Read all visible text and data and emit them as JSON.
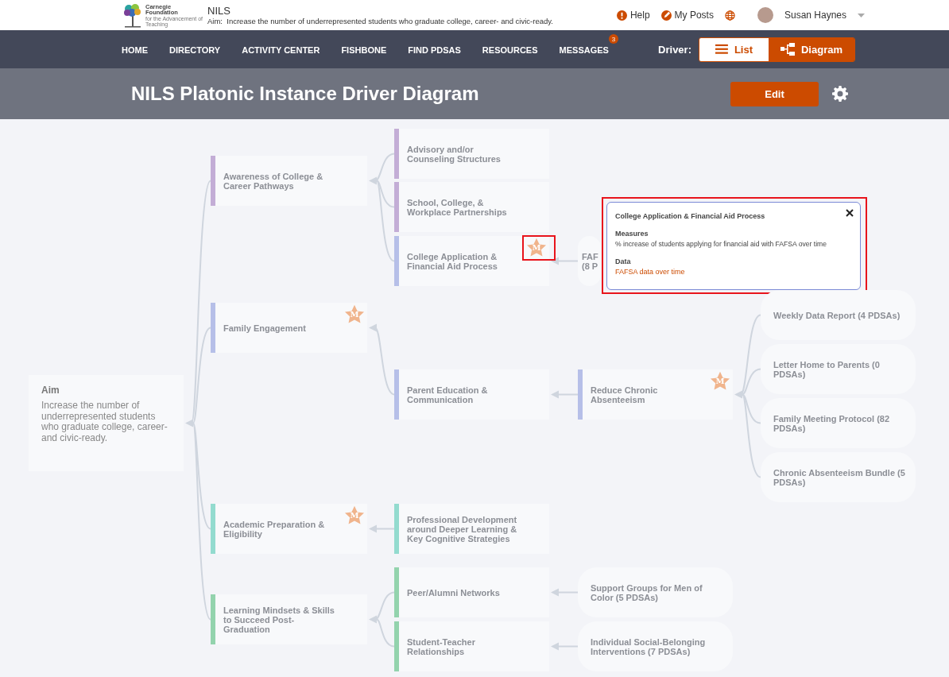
{
  "header": {
    "logo": {
      "name_lines": [
        "Carnegie",
        "Foundation"
      ],
      "tagline": "for the Advancement of Teaching"
    },
    "title": "NILS",
    "aim_line": "Aim:  Increase the number of underrepresented students who graduate college, career- and civic-ready.",
    "links": [
      {
        "kind": "help",
        "label": "Help"
      },
      {
        "kind": "posts",
        "label": "My Posts"
      },
      {
        "kind": "globe"
      }
    ],
    "user": {
      "name": "Susan Haynes"
    }
  },
  "nav": {
    "items": [
      {
        "label": "HOME"
      },
      {
        "label": "DIRECTORY"
      },
      {
        "label": "ACTIVITY CENTER"
      },
      {
        "label": "FISHBONE"
      },
      {
        "label": "FIND PDSAS"
      },
      {
        "label": "RESOURCES"
      },
      {
        "label": "MESSAGES",
        "badge": "3"
      }
    ],
    "driver_label": "Driver:",
    "views": [
      {
        "kind": "list",
        "label": "List",
        "selected": false
      },
      {
        "kind": "diagram",
        "label": "Diagram",
        "selected": true
      }
    ]
  },
  "page": {
    "title": "NILS Platonic Instance Driver Diagram",
    "edit_button": "Edit"
  },
  "diagram": {
    "aim": {
      "label": "Aim",
      "text": "Increase the number of underrepresented students who graduate college, career- and civic-ready."
    },
    "drivers": [
      {
        "kind": "driver",
        "label": "Awareness of College & Career Pathways",
        "color": "#c3add6",
        "children": [
          {
            "kind": "driver",
            "label": "Advisory and/or Counseling Structures",
            "color": "#c3add6"
          },
          {
            "kind": "driver",
            "label": "School, College, & Workplace Partnerships",
            "color": "#c3add6"
          },
          {
            "kind": "driver",
            "label": "College Application & Financial Aid Process",
            "color": "#b6bfe8",
            "badge": "M",
            "highlighted": true,
            "popup": {
              "title": "College Application & Financial Aid Process",
              "measures_heading": "Measures",
              "measures": "% increase of students applying for financial aid with FAFSA over time",
              "data_heading": "Data",
              "data": "FAFSA data over time",
              "highlighted": true
            },
            "children": [
              {
                "kind": "idea",
                "label": "FAF (8 P"
              }
            ]
          }
        ]
      },
      {
        "kind": "driver",
        "label": "Family Engagement",
        "color": "#b6bfe8",
        "badge": "M",
        "children": [
          {
            "kind": "driver",
            "label": "Parent Education & Communication",
            "color": "#b6bfe8",
            "children": [
              {
                "kind": "driver",
                "label": "Reduce Chronic Absenteeism",
                "color": "#b6bfe8",
                "badge": "M",
                "children": [
                  {
                    "kind": "idea",
                    "label": "Weekly Data Report (4 PDSAs)"
                  },
                  {
                    "kind": "idea",
                    "label": "Letter Home to Parents (0 PDSAs)"
                  },
                  {
                    "kind": "idea",
                    "label": "Family Meeting Protocol (82 PDSAs)"
                  },
                  {
                    "kind": "idea",
                    "label": "Chronic Absenteeism Bundle (5 PDSAs)"
                  }
                ]
              }
            ]
          }
        ]
      },
      {
        "kind": "driver",
        "label": "Academic Preparation & Eligibility",
        "color": "#93dbcf",
        "badge": "M",
        "children": [
          {
            "kind": "driver",
            "label": "Professional Development around Deeper Learning & Key Cognitive Strategies",
            "color": "#93dbcf"
          }
        ]
      },
      {
        "kind": "driver",
        "label": "Learning Mindsets & Skills to Succeed Post-Graduation",
        "color": "#93d3ad",
        "children": [
          {
            "kind": "driver",
            "label": "Peer/Alumni Networks",
            "color": "#93d3ad",
            "children": [
              {
                "kind": "idea",
                "label": "Support Groups for Men of Color (5 PDSAs)"
              }
            ]
          },
          {
            "kind": "driver",
            "label": "Student-Teacher Relationships",
            "color": "#93d3ad",
            "children": [
              {
                "kind": "idea",
                "label": "Individual Social-Belonging Interventions (7 PDSAs)"
              }
            ]
          }
        ]
      }
    ]
  }
}
